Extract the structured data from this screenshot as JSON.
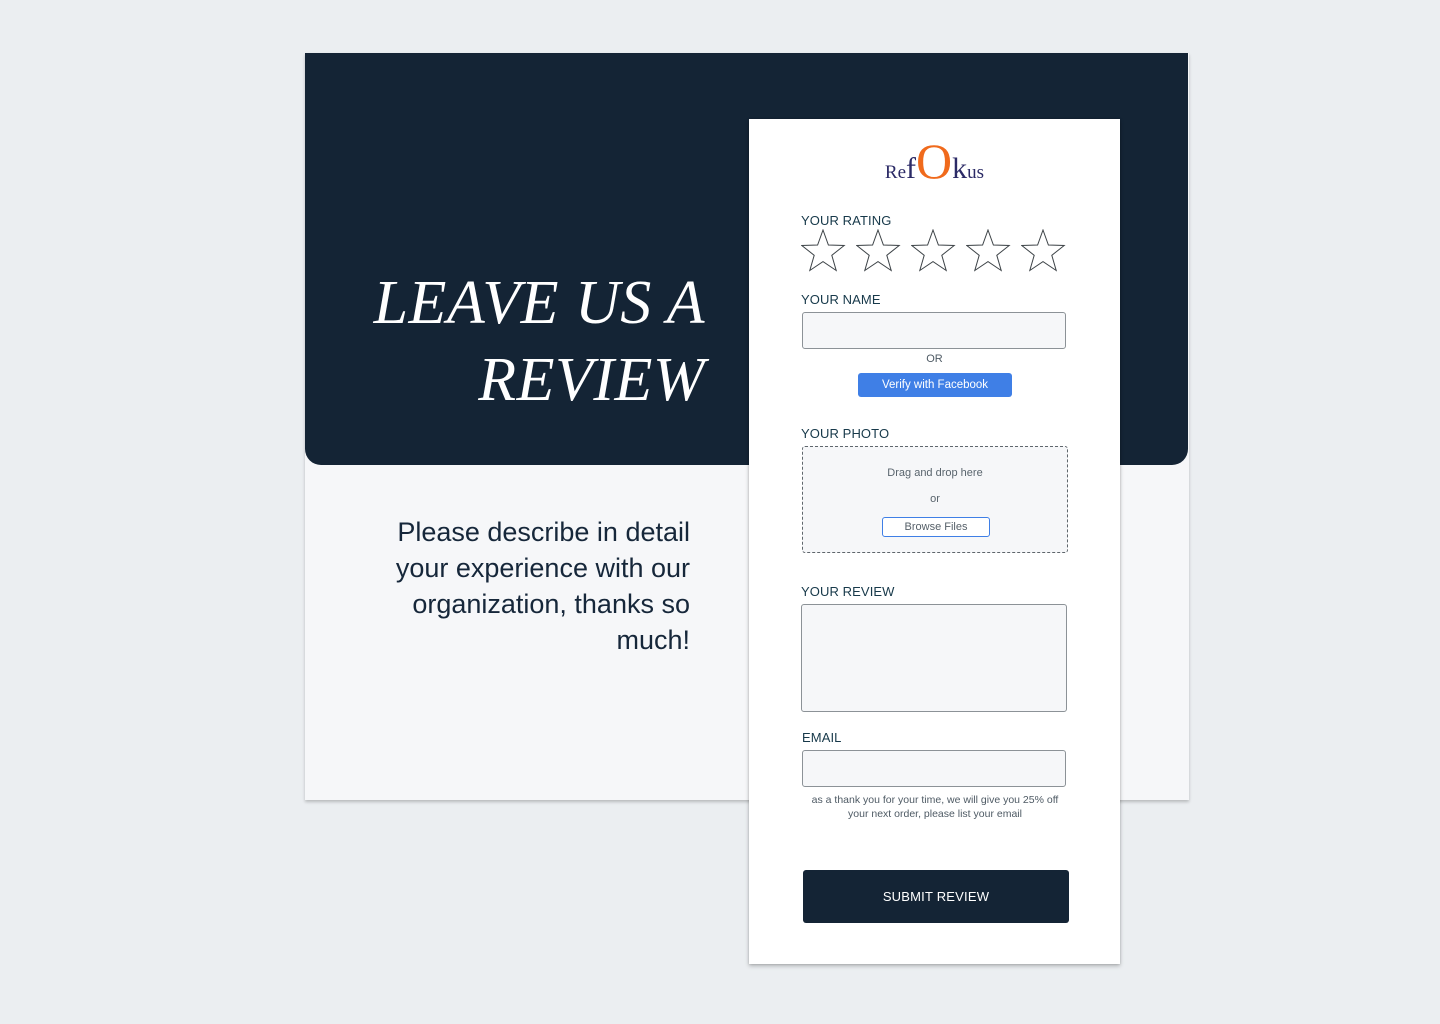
{
  "hero": {
    "title": "LEAVE US A REVIEW",
    "subtitle": "Please describe in detail your experience with our organization, thanks so much!"
  },
  "logo": {
    "text": "RefOkus",
    "parts": [
      "R",
      "e",
      "f",
      "O",
      "k",
      "us"
    ],
    "accent_color": "#f06a1c",
    "primary_color": "#2b2a66"
  },
  "form": {
    "rating": {
      "label": "YOUR RATING",
      "max": 5,
      "value": 0,
      "icon": "star-outline-icon"
    },
    "name": {
      "label": "YOUR NAME",
      "value": "",
      "placeholder": ""
    },
    "or_label": "OR",
    "facebook_button": "Verify with Facebook",
    "photo": {
      "label": "YOUR PHOTO",
      "drag_text": "Drag and drop here",
      "or_text": "or",
      "browse_button": "Browse Files"
    },
    "review": {
      "label": "YOUR REVIEW",
      "value": "",
      "placeholder": ""
    },
    "email": {
      "label": "EMAIL",
      "value": "",
      "placeholder": "",
      "note": "as a thank you for your time, we will give you 25% off your next order, please list your email"
    },
    "submit_button": "SUBMIT REVIEW"
  },
  "colors": {
    "navy": "#142435",
    "background": "#ebeef1",
    "panel": "#f6f7f9",
    "facebook_blue": "#3f7fe6",
    "label_text": "#17394a"
  }
}
